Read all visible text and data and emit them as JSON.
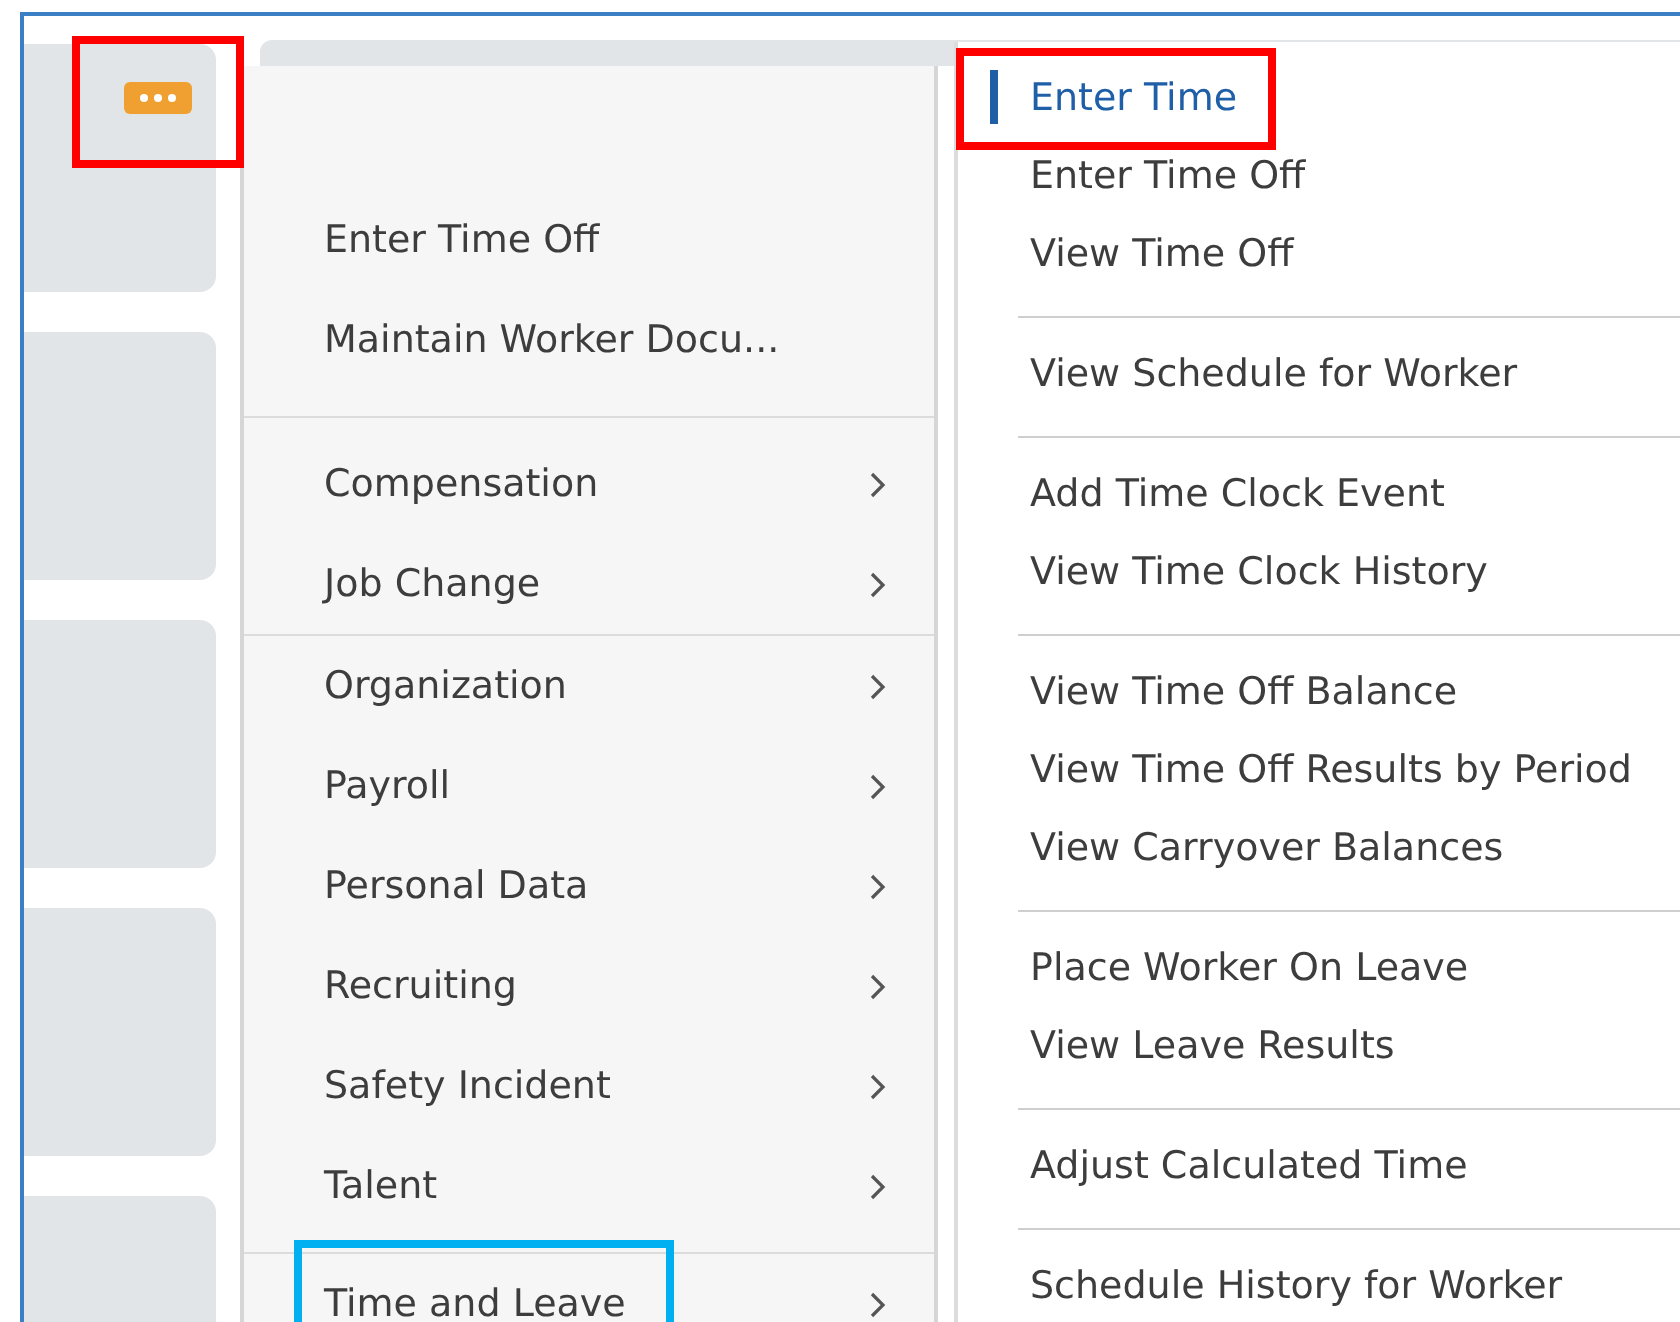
{
  "actions_button": {
    "color": "#ff0000"
  },
  "menu": {
    "groups": [
      {
        "items": [
          {
            "label": "Enter Time Off",
            "kind": "action"
          },
          {
            "label": "Maintain Worker Docu...",
            "kind": "action"
          }
        ]
      },
      {
        "items": [
          {
            "label": "Compensation",
            "kind": "category"
          },
          {
            "label": "Job Change",
            "kind": "category"
          }
        ]
      },
      {
        "items": [
          {
            "label": "Organization",
            "kind": "category"
          },
          {
            "label": "Payroll",
            "kind": "category"
          },
          {
            "label": "Personal Data",
            "kind": "category"
          },
          {
            "label": "Recruiting",
            "kind": "category"
          },
          {
            "label": "Safety Incident",
            "kind": "category"
          },
          {
            "label": "Talent",
            "kind": "category"
          }
        ]
      },
      {
        "items": [
          {
            "label": "Time and Leave",
            "kind": "category",
            "color": "#00b0f0"
          }
        ]
      }
    ]
  },
  "submenu": {
    "groups": [
      {
        "items": [
          {
            "label": "Enter Time",
            "selected": true,
            "color": "#ff0000"
          },
          {
            "label": "Enter Time Off",
            "selected": false
          },
          {
            "label": "View Time Off",
            "selected": false
          }
        ]
      },
      {
        "items": [
          {
            "label": "View Schedule for Worker",
            "selected": false
          }
        ]
      },
      {
        "items": [
          {
            "label": "Add Time Clock Event",
            "selected": false
          },
          {
            "label": "View Time Clock History",
            "selected": false
          }
        ]
      },
      {
        "items": [
          {
            "label": "View Time Off Balance",
            "selected": false
          },
          {
            "label": "View Time Off Results by Period",
            "selected": false
          },
          {
            "label": "View Carryover Balances",
            "selected": false
          }
        ]
      },
      {
        "items": [
          {
            "label": "Place Worker On Leave",
            "selected": false
          },
          {
            "label": "View Leave Results",
            "selected": false
          }
        ]
      },
      {
        "items": [
          {
            "label": "Adjust Calculated Time",
            "selected": false
          }
        ]
      },
      {
        "items": [
          {
            "label": "Schedule History for Worker",
            "selected": false
          }
        ]
      }
    ]
  }
}
